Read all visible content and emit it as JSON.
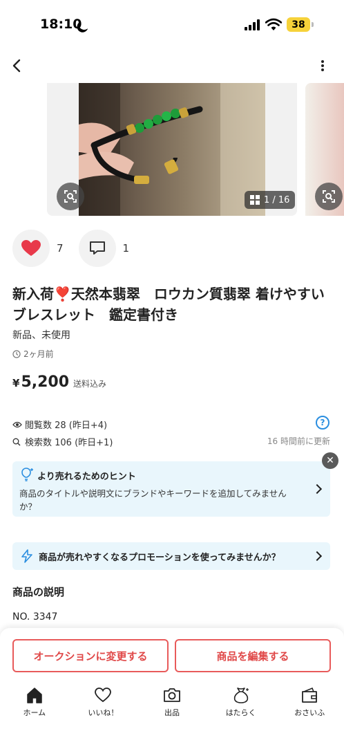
{
  "status_bar": {
    "time": "18:10",
    "battery": "38"
  },
  "gallery": {
    "counter": "1 / 16"
  },
  "reactions": {
    "likes": "7",
    "comments": "1"
  },
  "item": {
    "title": "新入荷❣️天然本翡翠　ロウカン質翡翠 着けやすいブレスレット　鑑定書付き",
    "condition": "新品、未使用",
    "posted": "2ヶ月前",
    "currency": "¥",
    "price": "5,200",
    "shipping": "送料込み"
  },
  "stats": {
    "views": "閲覧数  28 (昨日+4)",
    "searches": "検索数  106 (昨日+1)",
    "updated": "16 時間前に更新"
  },
  "hint": {
    "title": "より売れるためのヒント",
    "body": "商品のタイトルや説明文にブランドやキーワードを追加してみませんか？"
  },
  "promo": {
    "text": "商品が売れやすくなるプロモーションを使ってみませんか？"
  },
  "description": {
    "heading": "商品の説明",
    "first_line": "NO. 3347"
  },
  "actions": {
    "auction": "オークションに変更する",
    "edit": "商品を編集する"
  },
  "tabs": [
    {
      "label": "ホーム",
      "icon": "home-icon"
    },
    {
      "label": "いいね！",
      "icon": "heart-icon"
    },
    {
      "label": "出品",
      "icon": "camera-icon"
    },
    {
      "label": "はたらく",
      "icon": "money-bag-icon"
    },
    {
      "label": "おさいふ",
      "icon": "wallet-icon"
    }
  ],
  "colors": {
    "accent_red": "#e04848",
    "info_blue": "#2a8ee0",
    "hint_bg": "#e9f6fc",
    "like_red": "#e8394a"
  }
}
